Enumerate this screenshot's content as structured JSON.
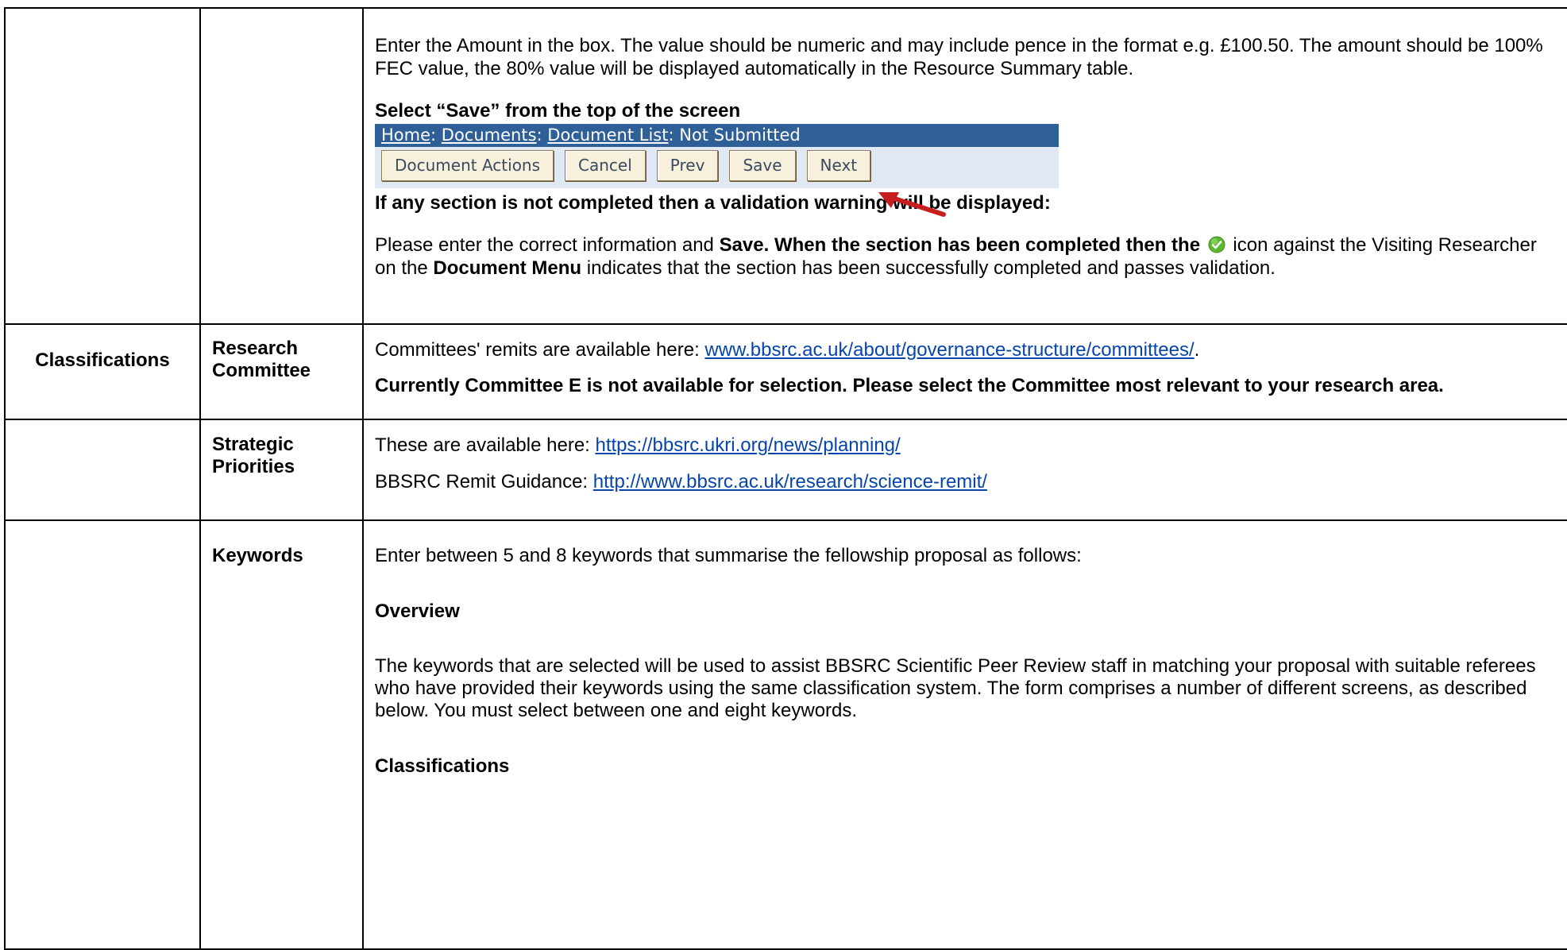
{
  "row1": {
    "amount_instructions": "Enter the Amount in the box. The value should be numeric and may include pence in the format e.g. £100.50. The amount should be 100% FEC value, the 80% value will be displayed automatically in the Resource Summary table.",
    "select_save": "Select “Save” from the top of the screen",
    "screenshot": {
      "breadcrumb": {
        "home": "Home",
        "documents": "Documents",
        "document_list": "Document List",
        "status": "Not Submitted",
        "separator": ":"
      },
      "buttons": {
        "document_actions": "Document Actions",
        "cancel": "Cancel",
        "prev": "Prev",
        "save": "Save",
        "next": "Next"
      }
    },
    "validation_warning": "If any section is not completed then a validation warning will be displayed:",
    "correct_info": {
      "part1": "Please enter the correct information and ",
      "part2_bold": "Save. When the section has been completed then the",
      "part3": " icon against the Visiting Researcher on the ",
      "part4_bold": "Document Menu",
      "part5": " indicates that the section has been successfully completed and passes validation."
    }
  },
  "row2": {
    "section": "Classifications",
    "sub": "Research Committee",
    "remits_text": "Committees' remits are available here: ",
    "remits_link": "www.bbsrc.ac.uk/about/governance-structure/committees/",
    "remits_suffix": ".",
    "committee_note": "Currently Committee E is not available for selection.  Please select the Committee most relevant to your research area."
  },
  "row3": {
    "sub": "Strategic Priorities",
    "available_text": "These are available here: ",
    "available_link": "https://bbsrc.ukri.org/news/planning/",
    "remit_text": "BBSRC Remit Guidance: ",
    "remit_link": "http://www.bbsrc.ac.uk/research/science-remit/"
  },
  "row4": {
    "sub": "Keywords",
    "intro": "Enter between 5 and 8 keywords that summarise the fellowship proposal as follows:",
    "overview_heading": "Overview",
    "overview_text": "The keywords that are selected will be used to assist BBSRC Scientific Peer Review staff in matching your proposal with suitable referees who have provided their keywords using the same classification system. The form comprises a number of different screens, as described below. You must select between one and eight keywords.",
    "classifications_heading": "Classifications"
  },
  "icons": {
    "check": "check-circle-icon",
    "arrow": "red-arrow-icon"
  },
  "colors": {
    "link": "#0645ad",
    "breadcrumb_bar": "#2e5f96",
    "button_bg": "#f7f0dc",
    "check_green": "#5cb82e",
    "arrow_red": "#c81e1e"
  }
}
